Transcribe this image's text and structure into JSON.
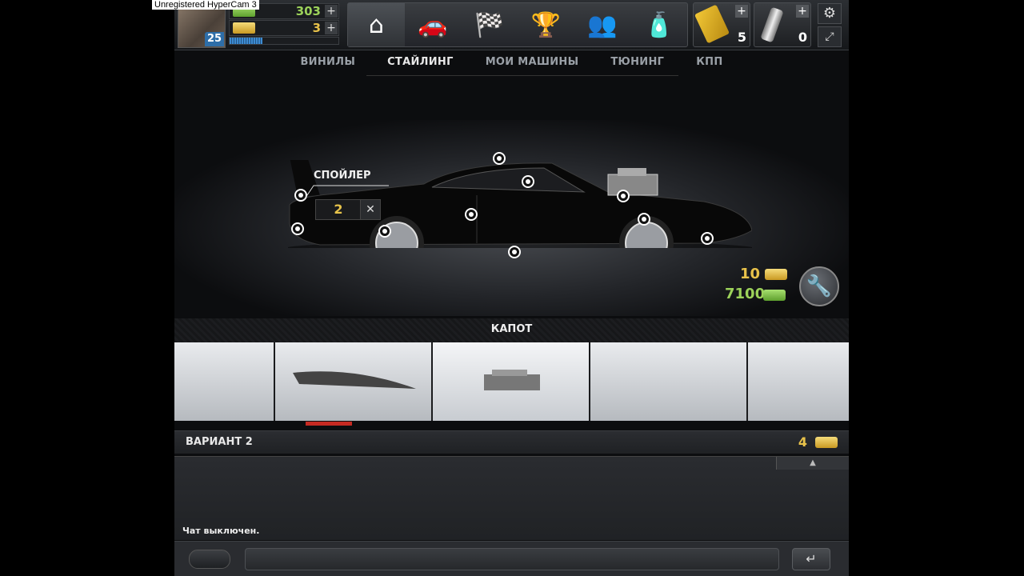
{
  "watermark": "Unregistered HyperCam 3",
  "player": {
    "level": "25",
    "cash": "303",
    "gold": "3"
  },
  "items": {
    "race_tickets": "5",
    "nitro": "0"
  },
  "tabs": [
    "ВИНИЛЫ",
    "СТАЙЛИНГ",
    "МОИ МАШИНЫ",
    "ТЮНИНГ",
    "КПП"
  ],
  "active_tab": "СТАЙЛИНГ",
  "editor": {
    "spoiler_label": "СПОЙЛЕР",
    "spoiler_value": "2",
    "close_glyph": "✕"
  },
  "price": {
    "gold": "10",
    "cash": "7100"
  },
  "parts": {
    "title": "КАПОТ",
    "variant_label": "ВАРИАНТ 2",
    "variant_cost": "4"
  },
  "chat": {
    "status": "Чат выключен.",
    "send_glyph": "↵"
  },
  "colors": {
    "gold": "#e8c24a",
    "cash": "#9cd25a",
    "accent_blue": "#2e6ea8",
    "selected_red": "#c62a22"
  }
}
